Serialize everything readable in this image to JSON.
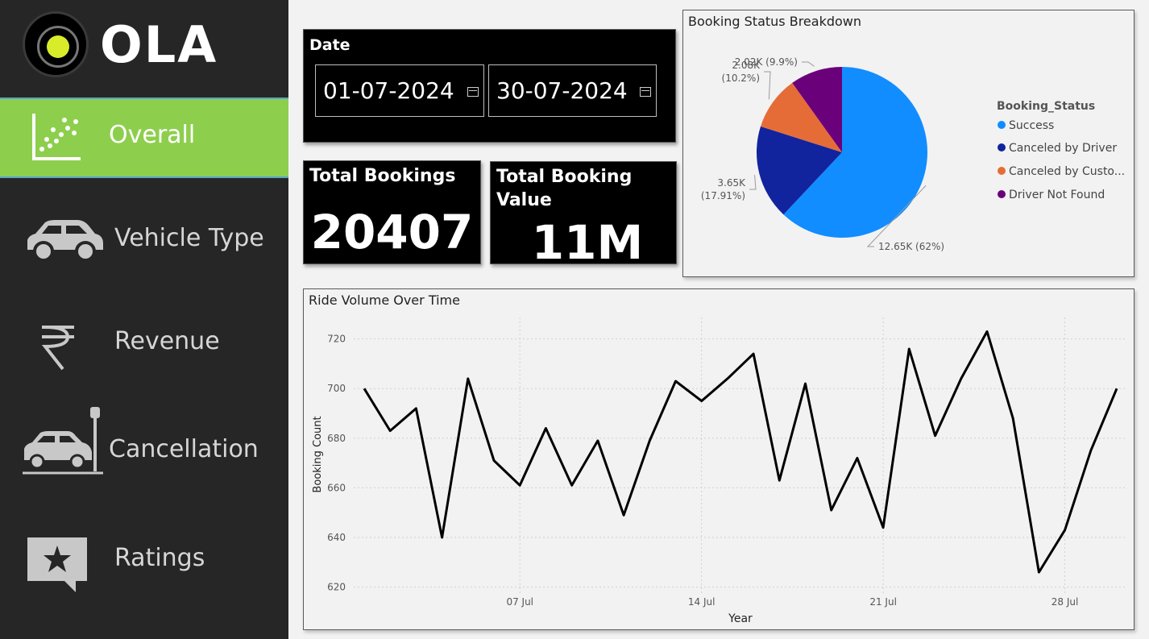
{
  "brand": {
    "name": "OLA"
  },
  "nav": [
    {
      "label": "Overall",
      "icon": "scatter-chart-icon",
      "active": true
    },
    {
      "label": "Vehicle Type",
      "icon": "car-icon",
      "active": false
    },
    {
      "label": "Revenue",
      "icon": "rupee-icon",
      "active": false
    },
    {
      "label": "Cancellation",
      "icon": "car-crash-icon",
      "active": false
    },
    {
      "label": "Ratings",
      "icon": "star-message-icon",
      "active": false
    }
  ],
  "date_filter": {
    "title": "Date",
    "start": "01-07-2024",
    "end": "30-07-2024"
  },
  "kpis": {
    "total_bookings": {
      "title": "Total Bookings",
      "value": "20407"
    },
    "total_value": {
      "title": "Total Booking Value",
      "value": "11M"
    }
  },
  "colors": {
    "accent_green": "#8dcf4d",
    "sidebar": "#262626",
    "success": "#118dff",
    "canceled_driver": "#12239e",
    "canceled_customer": "#e66c37",
    "driver_not_found": "#6b007b"
  },
  "chart_data": [
    {
      "type": "pie",
      "title": "Booking Status Breakdown",
      "legend_title": "Booking_Status",
      "legend_position": "right",
      "categories": [
        "Success",
        "Canceled by Driver",
        "Canceled by Customer",
        "Driver Not Found"
      ],
      "legend_labels": [
        "Success",
        "Canceled by Driver",
        "Canceled by Custo...",
        "Driver Not Found"
      ],
      "values": [
        12650,
        3650,
        2080,
        2020
      ],
      "data_labels": [
        "12.65K (62%)",
        "3.65K (17.91%)",
        "2.08K (10.2%)",
        "2.02K (9.9%)"
      ],
      "label_lines": [
        [
          "12.65K (62%)"
        ],
        [
          "3.65K",
          "(17.91%)"
        ],
        [
          "2.08K",
          "(10.2%)"
        ],
        [
          "2.02K (9.9%)"
        ]
      ],
      "colors": [
        "#118dff",
        "#12239e",
        "#e66c37",
        "#6b007b"
      ]
    },
    {
      "type": "line",
      "title": "Ride Volume Over Time",
      "xlabel": "Year",
      "ylabel": "Booking Count",
      "x": [
        "2024-07-01",
        "2024-07-02",
        "2024-07-03",
        "2024-07-04",
        "2024-07-05",
        "2024-07-06",
        "2024-07-07",
        "2024-07-08",
        "2024-07-09",
        "2024-07-10",
        "2024-07-11",
        "2024-07-12",
        "2024-07-13",
        "2024-07-14",
        "2024-07-15",
        "2024-07-16",
        "2024-07-17",
        "2024-07-18",
        "2024-07-19",
        "2024-07-20",
        "2024-07-21",
        "2024-07-22",
        "2024-07-23",
        "2024-07-24",
        "2024-07-25",
        "2024-07-26",
        "2024-07-27",
        "2024-07-28",
        "2024-07-29",
        "2024-07-30"
      ],
      "values": [
        700,
        683,
        692,
        640,
        704,
        671,
        661,
        684,
        661,
        679,
        649,
        679,
        703,
        695,
        704,
        714,
        663,
        702,
        651,
        672,
        644,
        716,
        681,
        704,
        723,
        688,
        626,
        643,
        675,
        700
      ],
      "ylim": [
        615,
        728
      ],
      "yticks": [
        620,
        640,
        660,
        680,
        700,
        720
      ],
      "xtick_labels": [
        "07 Jul",
        "14 Jul",
        "21 Jul",
        "28 Jul"
      ],
      "xtick_dates": [
        "2024-07-07",
        "2024-07-14",
        "2024-07-21",
        "2024-07-28"
      ],
      "grid": true,
      "color": "#000000"
    }
  ]
}
